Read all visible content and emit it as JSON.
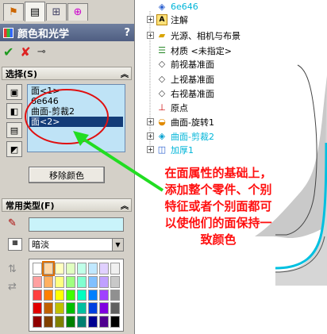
{
  "panel": {
    "title": "颜色和光学",
    "help": "?",
    "tabs": [
      {
        "icon": "feature-manager-icon"
      },
      {
        "icon": "property-manager-icon"
      },
      {
        "icon": "configuration-manager-icon"
      },
      {
        "icon": "dimxpert-icon"
      }
    ],
    "actions": {
      "ok_icon": "checkmark-icon",
      "cancel_icon": "cross-icon",
      "pin_icon": "pushpin-icon"
    }
  },
  "selection": {
    "header": "选择(S)",
    "items": [
      "面<1>",
      "6e646",
      "曲面-剪裁2",
      "面<2>"
    ],
    "selected_index": 3,
    "remove_label": "移除颜色"
  },
  "common_types": {
    "header": "常用类型(F)",
    "current_color": "#c9f3fa",
    "shade_value": "暗淡",
    "palette": [
      "#ffffff",
      "#ffd8a8",
      "#ffffc0",
      "#e0ffc0",
      "#c0ffe8",
      "#c0e8ff",
      "#e0d0ff",
      "#f0f0f0",
      "#ffa0a0",
      "#ffb060",
      "#ffff80",
      "#a0ff80",
      "#80ffd0",
      "#80c0ff",
      "#c0a0ff",
      "#c8c8c8",
      "#ff4040",
      "#ff8000",
      "#ffff00",
      "#40ff00",
      "#00ffc0",
      "#0080ff",
      "#a040ff",
      "#909090",
      "#e00000",
      "#c06000",
      "#c0c000",
      "#00c000",
      "#00c0a0",
      "#0040e0",
      "#8000e0",
      "#606060",
      "#900000",
      "#804000",
      "#808000",
      "#008000",
      "#008070",
      "#000090",
      "#500090",
      "#000000"
    ],
    "selected_palette_index": 1
  },
  "tree": {
    "nodes": [
      {
        "label": "6e646",
        "icon": "part-icon",
        "expander": ""
      },
      {
        "label": "注解",
        "icon": "annotation-icon",
        "expander": "+"
      },
      {
        "label": "光源、相机与布景",
        "icon": "lights-folder-icon",
        "expander": "+"
      },
      {
        "label": "材质 <未指定>",
        "icon": "material-icon",
        "expander": ""
      },
      {
        "label": "前视基准面",
        "icon": "plane-icon",
        "expander": ""
      },
      {
        "label": "上视基准面",
        "icon": "plane-icon",
        "expander": ""
      },
      {
        "label": "右视基准面",
        "icon": "plane-icon",
        "expander": ""
      },
      {
        "label": "原点",
        "icon": "origin-icon",
        "expander": ""
      },
      {
        "label": "曲面-旋转1",
        "icon": "surface-revolve-icon",
        "expander": "+"
      },
      {
        "label": "曲面-剪裁2",
        "icon": "surface-trim-icon",
        "expander": "+"
      },
      {
        "label": "加厚1",
        "icon": "thicken-icon",
        "expander": "+"
      }
    ]
  },
  "annotation": {
    "lines": [
      "在面属性的基础上，",
      "添加整个零件、个别",
      "特征或者个别面都可",
      "以使他们的面保持一",
      "致颜色"
    ]
  },
  "colors": {
    "callout_red": "#e01010",
    "arrow_green": "#22dd22",
    "highlight_cyan": "#00b5d8"
  }
}
